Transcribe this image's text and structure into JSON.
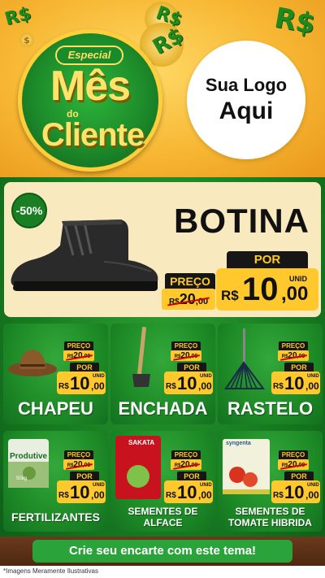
{
  "header": {
    "badge": {
      "especial": "Especial",
      "line1": "Mês",
      "do": "do",
      "line2": "Cliente"
    },
    "logo": {
      "line1": "Sua Logo",
      "line2": "Aqui"
    },
    "coin_glyph": "R$",
    "coin_small": "$"
  },
  "featured": {
    "discount": "-50%",
    "name": "BOTINA",
    "preco_label": "PREÇO",
    "old_currency": "R$",
    "old_int": "20",
    "old_dec": ",00",
    "por_label": "POR",
    "currency": "R$",
    "new_int": "10",
    "new_dec": ",00",
    "unid": "UNID"
  },
  "products": [
    {
      "name": "CHAPEU",
      "preco_label": "PREÇO",
      "old_currency": "R$",
      "old_int": "20",
      "old_dec": ",00",
      "por_label": "POR",
      "currency": "R$",
      "new_int": "10",
      "new_dec": ",00",
      "unid": "UNID"
    },
    {
      "name": "ENCHADA",
      "preco_label": "PREÇO",
      "old_currency": "R$",
      "old_int": "20",
      "old_dec": ",00",
      "por_label": "POR",
      "currency": "R$",
      "new_int": "10",
      "new_dec": ",00",
      "unid": "UNID"
    },
    {
      "name": "RASTELO",
      "preco_label": "PREÇO",
      "old_currency": "R$",
      "old_int": "20",
      "old_dec": ",00",
      "por_label": "POR",
      "currency": "R$",
      "new_int": "10",
      "new_dec": ",00",
      "unid": "UNID"
    },
    {
      "name": "FERTILIZANTES",
      "preco_label": "PREÇO",
      "old_currency": "R$",
      "old_int": "20",
      "old_dec": ",00",
      "por_label": "POR",
      "currency": "R$",
      "new_int": "10",
      "new_dec": ",00",
      "unid": "UNID",
      "pack_brand": "Produtive",
      "pack_weight": "50kg"
    },
    {
      "name": "SEMENTES DE",
      "name2": "ALFACE",
      "preco_label": "PREÇO",
      "old_currency": "R$",
      "old_int": "20",
      "old_dec": ",00",
      "por_label": "POR",
      "currency": "R$",
      "new_int": "10",
      "new_dec": ",00",
      "unid": "UNID",
      "pack_brand": "SAKATA"
    },
    {
      "name": "SEMENTES DE",
      "name2": "TOMATE HIBRIDA",
      "preco_label": "PREÇO",
      "old_currency": "R$",
      "old_int": "20",
      "old_dec": ",00",
      "por_label": "POR",
      "currency": "R$",
      "new_int": "10",
      "new_dec": ",00",
      "unid": "UNID",
      "pack_brand": "syngenta"
    }
  ],
  "cta": "Crie seu encarte com este tema!",
  "footnote": "*Imagens Meramente Ilustrativas",
  "colors": {
    "green": "#1d8a26",
    "yellow": "#ffc82c",
    "dark": "#161616",
    "cream": "#f9e9bf"
  }
}
